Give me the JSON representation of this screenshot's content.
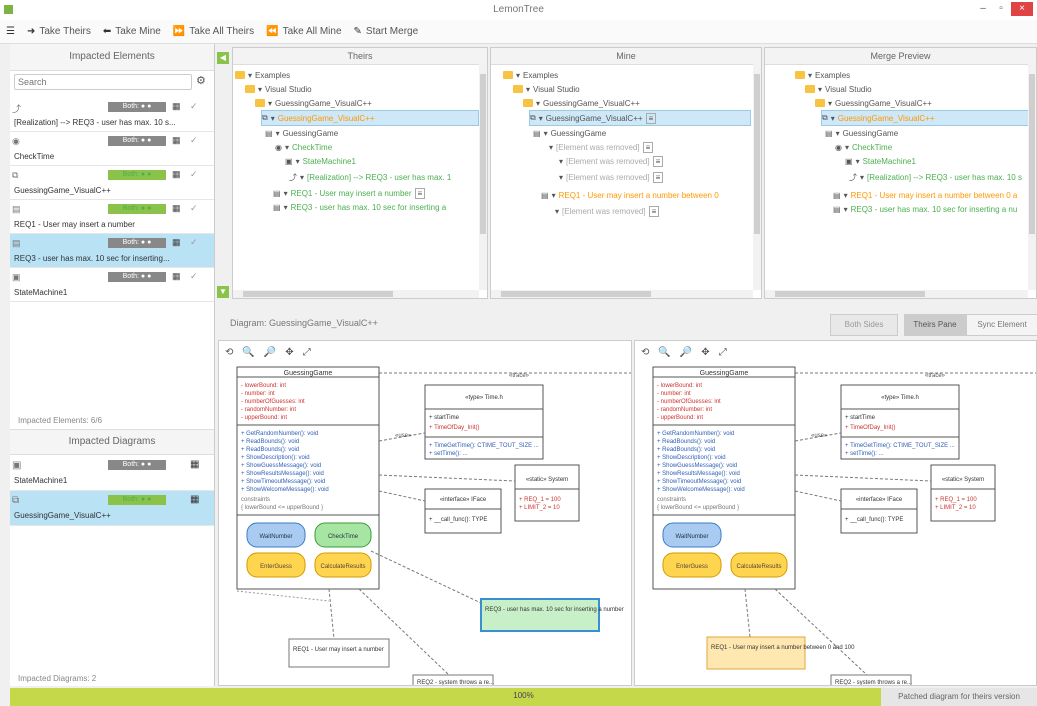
{
  "window": {
    "title": "LemonTree"
  },
  "toolbar": {
    "items": [
      {
        "icon": "menu-icon",
        "label": ""
      },
      {
        "icon": "arrow-right-icon",
        "label": "Take Theirs"
      },
      {
        "icon": "arrow-left-icon",
        "label": "Take Mine"
      },
      {
        "icon": "double-arrow-right-icon",
        "label": "Take All Theirs"
      },
      {
        "icon": "double-arrow-left-icon",
        "label": "Take All Mine"
      },
      {
        "icon": "merge-icon",
        "label": "Start Merge"
      }
    ]
  },
  "left": {
    "impacted_elements_header": "Impacted Elements",
    "search_placeholder": "Search",
    "elements": [
      {
        "label": "[Realization] --> REQ3 - user has max. 10 s...",
        "badge": "Both: ● ●",
        "selected": false
      },
      {
        "label": "CheckTime",
        "badge": "Both: ● ●",
        "selected": false
      },
      {
        "label": "GuessingGame_VisualC++",
        "badge": "Both: ● ●",
        "selected": false
      },
      {
        "label": "REQ1 - User may insert a number",
        "badge": "Both: ● ●",
        "selected": false
      },
      {
        "label": "REQ3 - user has max. 10 sec for inserting...",
        "badge": "Both: ● ●",
        "selected": true
      },
      {
        "label": "StateMachine1",
        "badge": "Both: ● ●",
        "selected": false
      }
    ],
    "impacted_elements_count": "Impacted Elements: 6/6",
    "impacted_diagrams_header": "Impacted Diagrams",
    "diagrams": [
      {
        "label": "StateMachine1",
        "badge": "Both: ● ●",
        "selected": false
      },
      {
        "label": "GuessingGame_VisualC++",
        "badge": "Both: ● ●",
        "selected": true
      }
    ],
    "impacted_diagrams_count": "Impacted Diagrams: 2"
  },
  "trees": {
    "theirs_title": "Theirs",
    "mine_title": "Mine",
    "preview_title": "Merge Preview",
    "examples": "Examples",
    "visual_studio": "Visual Studio",
    "gg_visualc": "GuessingGame_VisualC++",
    "gg_visualc_short": "GuessingGame_VisualC++",
    "guessing_game": "GuessingGame",
    "check_time": "CheckTime",
    "state_machine": "StateMachine1",
    "realization": "[Realization] --> REQ3 - user has max. 1",
    "req1": "REQ1 - User may insert a number",
    "req3": "REQ3 - user has max. 10 sec for inserting a",
    "removed1": "[Element was removed]",
    "removed2": "[Element was removed]",
    "removed3": "[Element was removed]",
    "removed4": "[Element was removed]",
    "mine_req1": "REQ1 - User may insert a number between 0",
    "pv_gg": "GuessingGame_VisualC++",
    "pv_realization": "[Realization] --> REQ3 - user has max. 10 s",
    "pv_req1": "REQ1 - User may insert a number between 0 a",
    "pv_req3": "REQ3 - user has max. 10 sec for inserting a nu"
  },
  "diagram": {
    "title": "Diagram: GuessingGame_VisualC++",
    "btn_both": "Both Sides",
    "btn_theirs": "Theirs Pane",
    "btn_sync": "Sync Element"
  },
  "canvas": {
    "class_name": "GuessingGame",
    "attrs": [
      "- lowerBound: int",
      "- number: int",
      "- numberOfGuesses: int",
      "- randomNumber: int",
      "- upperBound: int"
    ],
    "ops": [
      "+ GetRandomNumber(): void",
      "+ ReadBounds(): void",
      "+ ReadBounds(): void",
      "+ ShowDescription(): void",
      "+ ShowGuessMessage(): void",
      "+ ShowResultsMessage(): void",
      "+ ShowTimeoutMessage(): void",
      "+ ShowWelcomeMessage(): void"
    ],
    "constraints": "constraints",
    "constraint_val": "{ lowerBound <= upperBound }",
    "state1": "WaitNumber",
    "state2": "CheckTime",
    "state3": "EnterGuess",
    "state4": "CalculateResults",
    "time_title": "«type»\nTime.h",
    "time_attr1": "+ startTime",
    "time_attr2": "+ TimeOfDay_Init()",
    "time_ops": [
      "+ TimeGetTime(): CTIME_TOUT_SIZE ...",
      "+ setTime(): ..."
    ],
    "iface_title": "«interface»\nIFace",
    "iface_op": "+ __call_func(): TYPE",
    "system_title": "«static»\nSystem",
    "system_ops": [
      "+ REQ_1 = 100",
      "+ LIMIT_2 = 10"
    ],
    "note_req3": "REQ3 - user has max. 10 sec for inserting a number",
    "note_req1": "REQ1 - User may insert a number",
    "note_req1b": "REQ1 - User may insert a number between 0 and 100",
    "note_bottom": "REQ2 - system throws a re...",
    "label_realize": "«trace»",
    "label_use": "«use»"
  },
  "status": {
    "percent": "100%",
    "right": "Patched diagram for theirs version"
  }
}
